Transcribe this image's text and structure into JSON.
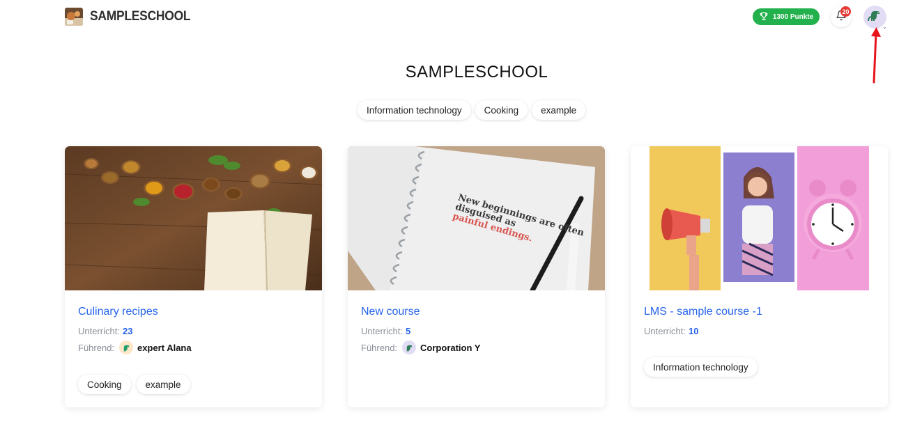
{
  "header": {
    "brand": "SAMPLESCHOOL",
    "points_label": "1300 Punkte",
    "notifications_count": "20"
  },
  "page": {
    "title": "SAMPLESCHOOL",
    "category_chips": [
      "Information technology",
      "Cooking",
      "example"
    ]
  },
  "courses": [
    {
      "title": "Culinary recipes",
      "lessons_label": "Unterricht:",
      "lessons_count": "23",
      "leader_label": "Führend:",
      "leader_name": "expert Alana",
      "tags": [
        "Cooking",
        "example"
      ]
    },
    {
      "title": "New course",
      "lessons_label": "Unterricht:",
      "lessons_count": "5",
      "leader_label": "Führend:",
      "leader_name": "Corporation Y",
      "tags": [],
      "image_text_line1": "New beginnings are often",
      "image_text_line2": "disguised as",
      "image_text_line3": "painful endings."
    },
    {
      "title": "LMS - sample course -1",
      "lessons_label": "Unterricht:",
      "lessons_count": "10",
      "tags": [
        "Information technology"
      ]
    }
  ],
  "colors": {
    "accent": "#2563eb",
    "points_green": "#22b14c",
    "badge_red": "#e53935",
    "arrow_red": "#e8141c"
  },
  "icons": {
    "points": "trophy-icon",
    "notifications": "bell-icon",
    "avatar": "dinosaur-icon"
  }
}
